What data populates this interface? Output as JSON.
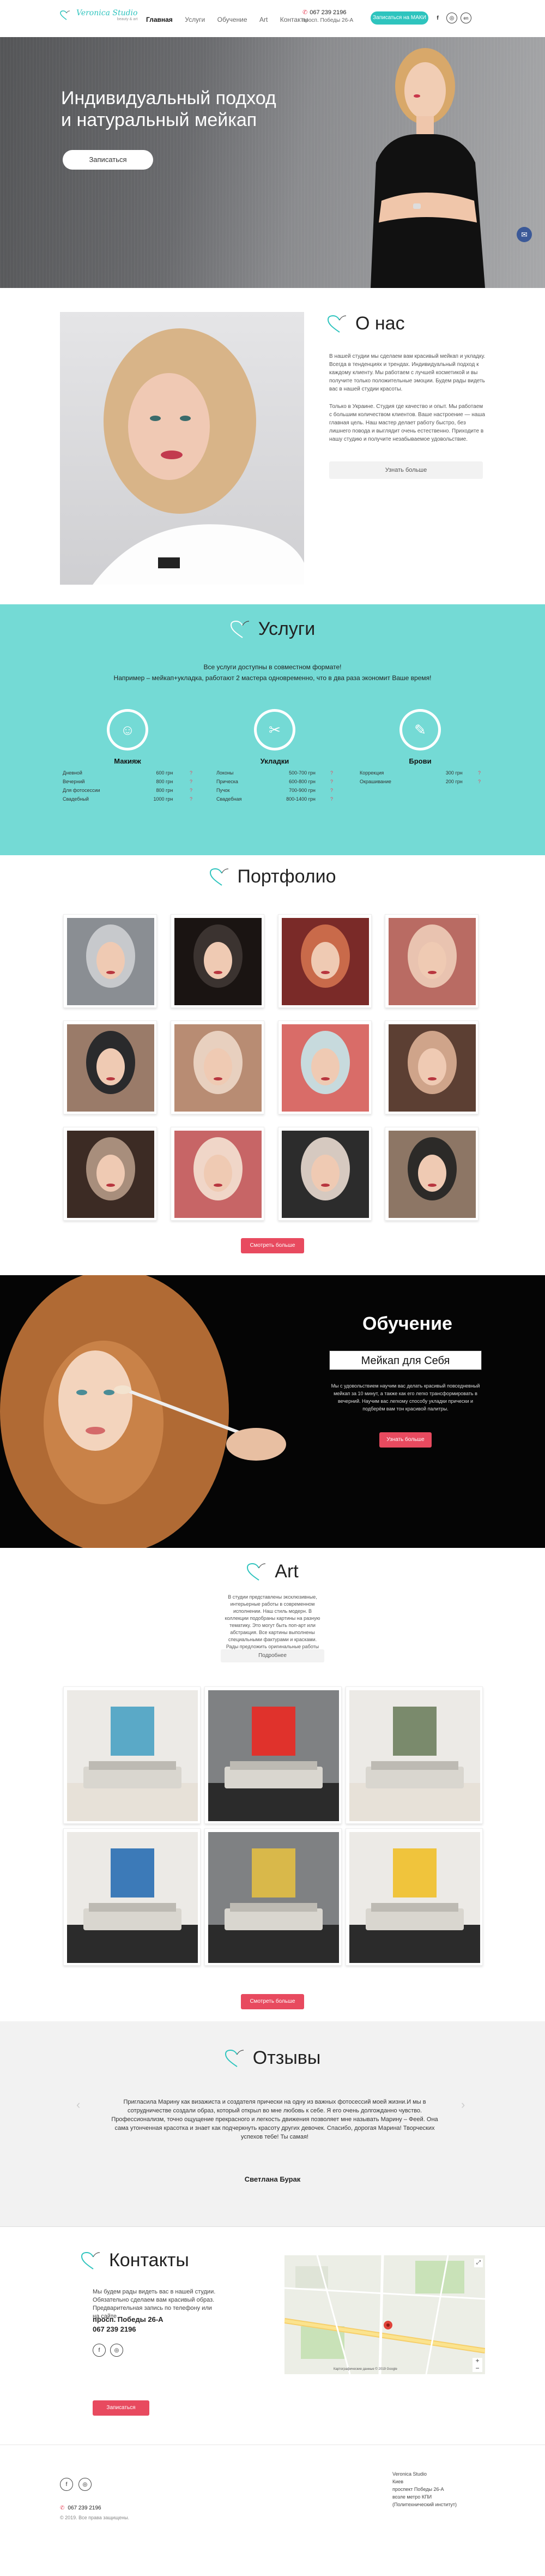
{
  "header": {
    "logo": {
      "name": "Veronica Studio",
      "tagline": "beauty & art"
    },
    "nav": [
      "Главная",
      "Услуги",
      "Обучение",
      "Art",
      "Контакты"
    ],
    "phone": "067 239 2196",
    "address": "просп. Победы 26-А",
    "cta": "Записаться на МАКИ",
    "social": [
      "f",
      "ig",
      "en"
    ]
  },
  "hero": {
    "title_line1": "Индивидуальный подход",
    "title_line2": "и натуральный мейкап",
    "button": "Записаться"
  },
  "about": {
    "title": "О нас",
    "p1": "В нашей студии мы сделаем вам красивый мейкап и укладку. Всегда в тенденциях и трендах. Индивидуальный подход к каждому клиенту. Мы работаем с лучшей косметикой и вы получите только положительные эмоции. Будем рады видеть вас в нашей студии красоты.",
    "p2": "Только в Украине. Студия где качество и опыт. Мы работаем с большим количеством клиентов. Ваше настроение — наша главная цель. Наш мастер делает работу быстро, без лишнего повода и выглядит очень естественно. Приходите в нашу студию и получите незабываемое удовольствие.",
    "button": "Узнать больше"
  },
  "services": {
    "title": "Услуги",
    "sub1": "Все услуги доступны в совместном формате!",
    "sub2": "Например – мейкап+укладка, работают 2 мастера одновременно, что в два раза экономит Ваше время!",
    "cols": [
      {
        "name": "Макияж",
        "icon": "face-icon",
        "rows": [
          [
            "Дневной",
            "600 грн",
            "?"
          ],
          [
            "Вечерний",
            "800 грн",
            "?"
          ],
          [
            "Для фотосессии",
            "800 грн",
            "?"
          ],
          [
            "Свадебный",
            "1000 грн",
            "?"
          ]
        ]
      },
      {
        "name": "Укладки",
        "icon": "hairdryer-icon",
        "rows": [
          [
            "Локоны",
            "500-700 грн",
            "?"
          ],
          [
            "Прическа",
            "600-800 грн",
            "?"
          ],
          [
            "Пучок",
            "700-900 грн",
            "?"
          ],
          [
            "Свадебная",
            "800-1400 грн",
            "?"
          ]
        ]
      },
      {
        "name": "Брови",
        "icon": "brow-icon",
        "rows": [
          [
            "Коррекция",
            "300 грн",
            "?"
          ],
          [
            "Окрашивание",
            "200 грн",
            "?"
          ]
        ]
      }
    ]
  },
  "portfolio": {
    "title": "Портфолио",
    "button": "Смотреть больше"
  },
  "education": {
    "title": "Обучение",
    "subtitle": "Мейкап для Себя",
    "text": "Мы с удовольствием научим вас делать красивый повседневный мейкап за 10 минут, а также как его легко трансформировать в вечерний. Научим вас легкому способу укладки прически и подберём вам тон красивой палитры.",
    "button": "Узнать больше"
  },
  "art": {
    "title": "Art",
    "text": "В студии представлены эксклюзивные, интерьерные работы в современном исполнении. Наш стиль модерн. В коллекции подобраны картины на разную тематику. Это могут быть поп-арт или абстракция. Все картины выполнены специальными фактурами и красками. Рады предложить оригинальные работы для вашего интерьера и вашего вкуса.",
    "button_small": "Подробнее",
    "button": "Смотреть больше"
  },
  "reviews": {
    "title": "Отзывы",
    "text": "Пригласила Марину как визажиста и создателя прически на одну из важных фотосессий моей жизни.И мы в сотрудничестве создали образ, который открыл во мне любовь к себе. Я его очень долгожданно чувство. Профессионализм, точно ощущение прекрасного и легкость движения позволяет мне называть Марину – Феей. Она сама утонченная красотка и знает как подчеркнуть красоту других девочек. Спасибо, дорогая Марина! Творческих успехов тебе! Ты самая!",
    "author": "Светлана Бурак"
  },
  "contacts": {
    "title": "Контакты",
    "text": "Мы будем рады видеть вас в нашей студии. Обязательно сделаем вам красивый образ. Предварительная запись по телефону или на сайте.",
    "address": "просп. Победы 26-А",
    "phone": "067 239 2196",
    "button": "Записаться",
    "map_credit": "Картографические данные © 2019 Google"
  },
  "footer": {
    "phone": "067 239 2196",
    "copyright": "© 2019. Все права защищены.",
    "address_lines": [
      "Veronica Studio",
      "Киев",
      "проспект Победы 26-А",
      "возле метро КПИ",
      "(Политехнический институт)"
    ]
  },
  "colors": {
    "accent": "#2ec4be",
    "services_bg": "#74dad5",
    "cta_red": "#e84a5f"
  }
}
